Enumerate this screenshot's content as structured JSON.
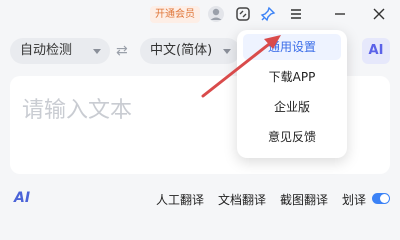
{
  "titlebar": {
    "vip_label": "开通会员",
    "icons": [
      "avatar-icon",
      "screenshot-icon",
      "pin-icon",
      "menu-icon",
      "minimize-icon",
      "close-icon"
    ]
  },
  "toolbar": {
    "source_lang": "自动检测",
    "target_lang": "中文(简体)",
    "ai_label": "AI"
  },
  "editor": {
    "placeholder": "请输入文本"
  },
  "bottom": {
    "ai_mark": "AI",
    "links": [
      "人工翻译",
      "文档翻译",
      "截图翻译",
      "划译"
    ]
  },
  "menu": {
    "items": [
      "通用设置",
      "下载APP",
      "企业版",
      "意见反馈"
    ],
    "active_index": 0
  },
  "colors": {
    "accent": "#3b6de8",
    "vip": "#e0773a",
    "annotation_arrow": "#d94b4b"
  }
}
